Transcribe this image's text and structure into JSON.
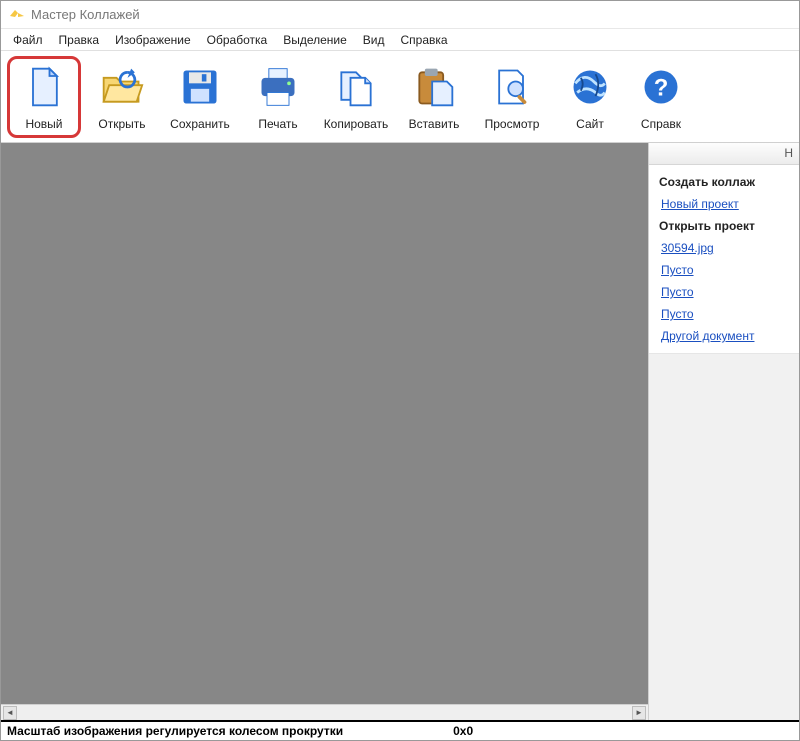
{
  "titlebar": {
    "title": "Мастер Коллажей"
  },
  "menubar": {
    "items": [
      "Файл",
      "Правка",
      "Изображение",
      "Обработка",
      "Выделение",
      "Вид",
      "Справка"
    ]
  },
  "toolbar": {
    "items": [
      {
        "name": "new",
        "label": "Новый",
        "icon": "new-file-icon",
        "highlighted": true
      },
      {
        "name": "open",
        "label": "Открыть",
        "icon": "open-folder-icon"
      },
      {
        "name": "save",
        "label": "Сохранить",
        "icon": "save-disk-icon"
      },
      {
        "name": "print",
        "label": "Печать",
        "icon": "printer-icon"
      },
      {
        "name": "copy",
        "label": "Копировать",
        "icon": "copy-icon"
      },
      {
        "name": "paste",
        "label": "Вставить",
        "icon": "paste-icon"
      },
      {
        "name": "view",
        "label": "Просмотр",
        "icon": "magnifier-icon"
      },
      {
        "name": "site",
        "label": "Сайт",
        "icon": "globe-icon"
      },
      {
        "name": "help",
        "label": "Справк",
        "icon": "help-icon"
      }
    ]
  },
  "side": {
    "header": "Н",
    "group1_title": "Создать коллаж",
    "link_new_project": "Новый проект",
    "group2_title": "Открыть проект",
    "recent": [
      "30594.jpg",
      "Пусто",
      "Пусто",
      "Пусто"
    ],
    "link_other": "Другой документ"
  },
  "statusbar": {
    "hint": "Масштаб изображения регулируется колесом прокрутки",
    "dims": "0x0"
  }
}
